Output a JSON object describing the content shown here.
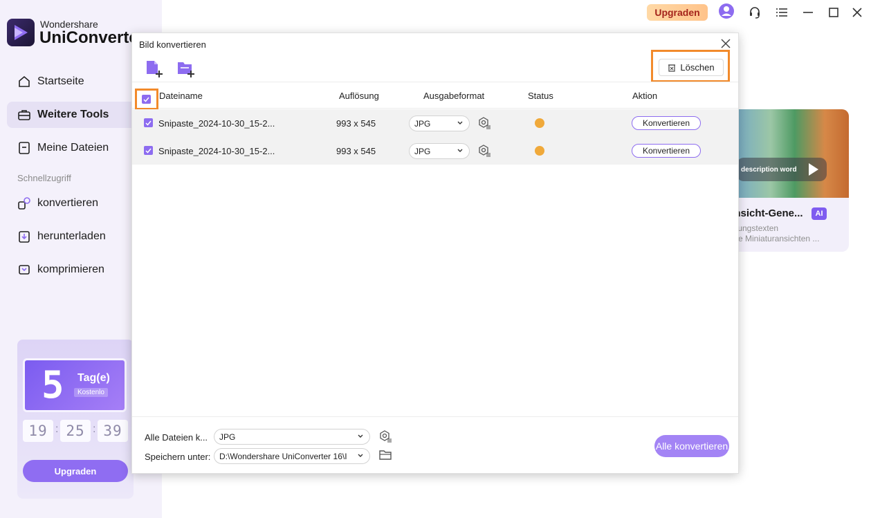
{
  "app": {
    "brand_top": "Wondershare",
    "brand_main": "UniConverter",
    "upgrade_label": "Upgraden"
  },
  "sidebar": {
    "items": [
      {
        "label": "Startseite",
        "icon": "home-icon"
      },
      {
        "label": "Weitere Tools",
        "icon": "toolbox-icon"
      },
      {
        "label": "Meine Dateien",
        "icon": "file-icon"
      }
    ],
    "quick_access_label": "Schnellzugriff",
    "quick_items": [
      {
        "label": "konvertieren",
        "icon": "convert-icon"
      },
      {
        "label": "herunterladen",
        "icon": "download-icon"
      },
      {
        "label": "komprimieren",
        "icon": "compress-icon"
      }
    ]
  },
  "promo": {
    "days": "5",
    "days_label": "Tag(e)",
    "free_label": "Kostenlo",
    "timer": [
      "19",
      "25",
      "39"
    ],
    "button": "Upgraden"
  },
  "background_card": {
    "pill_text": "description word",
    "title": "ansicht-Gene...",
    "badge": "AI",
    "sub1": "lerungstexten",
    "sub2": "erte Miniaturansichten ..."
  },
  "dialog": {
    "title": "Bild konvertieren",
    "delete_label": "Löschen",
    "columns": {
      "name": "Dateiname",
      "resolution": "Auflösung",
      "format": "Ausgabeformat",
      "status": "Status",
      "action": "Aktion"
    },
    "rows": [
      {
        "name": "Snipaste_2024-10-30_15-2...",
        "resolution": "993 x 545",
        "format": "JPG",
        "action": "Konvertieren"
      },
      {
        "name": "Snipaste_2024-10-30_15-2...",
        "resolution": "993 x 545",
        "format": "JPG",
        "action": "Konvertieren"
      }
    ],
    "footer": {
      "all_files_label": "Alle Dateien k...",
      "all_format": "JPG",
      "save_label": "Speichern unter:",
      "save_path": "D:\\Wondershare UniConverter 16\\I",
      "convert_all": "Alle konvertieren"
    }
  },
  "colors": {
    "accent": "#8d6cf0",
    "highlight": "#f28a2b",
    "status_pending": "#f0a93a"
  }
}
